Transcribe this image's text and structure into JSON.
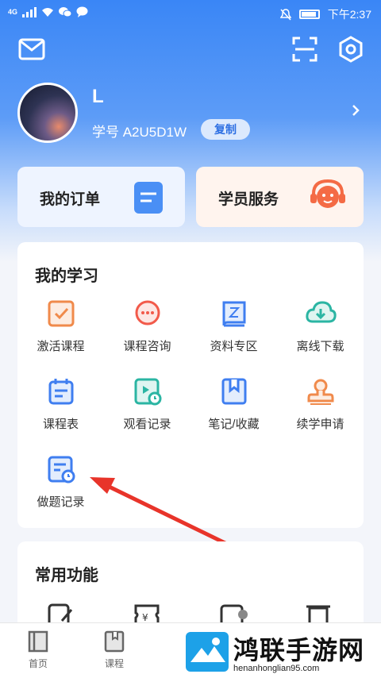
{
  "status_bar": {
    "time": "下午2:37",
    "network": "4G"
  },
  "profile": {
    "name": "L",
    "student_id": "学号 A2U5D1W",
    "copy_label": "复制"
  },
  "quick_cards": {
    "order": "我的订单",
    "service": "学员服务"
  },
  "my_study": {
    "title": "我的学习",
    "items": [
      {
        "label": "激活课程",
        "icon": "check-box-icon",
        "color": "#f08a4b"
      },
      {
        "label": "课程咨询",
        "icon": "chat-bubble-icon",
        "color": "#f25a4a"
      },
      {
        "label": "资料专区",
        "icon": "book-icon",
        "color": "#3f7ef0"
      },
      {
        "label": "离线下载",
        "icon": "cloud-download-icon",
        "color": "#2bb5a3"
      },
      {
        "label": "课程表",
        "icon": "calendar-icon",
        "color": "#3f7ef0"
      },
      {
        "label": "观看记录",
        "icon": "video-history-icon",
        "color": "#2bb5a3"
      },
      {
        "label": "笔记/收藏",
        "icon": "bookmark-icon",
        "color": "#3f7ef0"
      },
      {
        "label": "续学申请",
        "icon": "stamp-icon",
        "color": "#f08a4b"
      },
      {
        "label": "做题记录",
        "icon": "quiz-history-icon",
        "color": "#3f7ef0"
      }
    ]
  },
  "common_functions": {
    "title": "常用功能"
  },
  "tab_bar": {
    "tabs": [
      {
        "label": "首页"
      },
      {
        "label": "课程"
      }
    ]
  },
  "watermark": {
    "text": "鸿联手游网",
    "url": "henanhonglian95.com"
  }
}
